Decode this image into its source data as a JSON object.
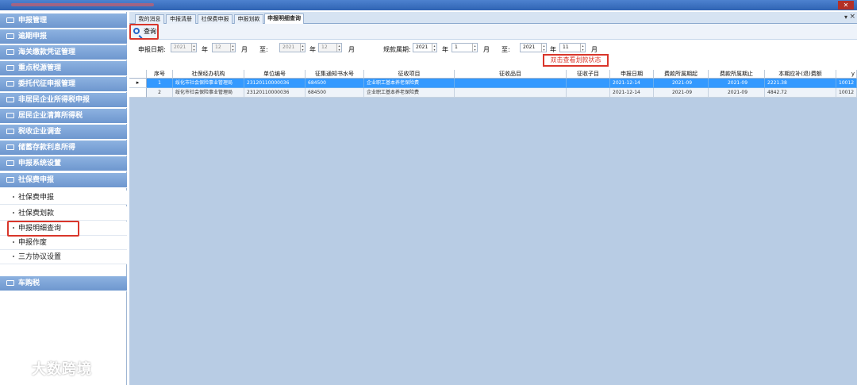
{
  "tabs": [
    "我的消息",
    "申报清册",
    "社保费申报",
    "申报划款",
    "申报明细查询"
  ],
  "toolbar": {
    "query_label": "查询"
  },
  "sidebar": {
    "top_items": [
      "申报管理",
      "逾期申报",
      "海关缴款凭证管理",
      "重点税源管理",
      "委托代征申报管理",
      "非居民企业所得税申报",
      "居民企业清算所得税",
      "税收企业调查",
      "储蓄存款利息所得",
      "申报系统设置",
      "社保费申报"
    ],
    "sub_items": [
      "社保费申报",
      "社保费划款",
      "申报明细查询",
      "申报作废",
      "三方协议设置"
    ],
    "bottom_item": "车购税"
  },
  "filter": {
    "declare_date_label": "申报日期:",
    "from_year": "2021",
    "year_unit": "年",
    "from_month": "12",
    "month_unit": "月",
    "to_label": "至:",
    "to_year": "2021",
    "to_month": "12",
    "period_label": "规款属期:",
    "period_from_year": "2021",
    "period_from_month": "1",
    "period_to_year": "2021",
    "period_to_month": "11",
    "hint": "双击查看划款状态"
  },
  "table": {
    "columns": [
      "序号",
      "社保经办机构",
      "单位编号",
      "征集通知书水号",
      "征收项目",
      "征收品目",
      "征收子目",
      "申报日期",
      "费款所属期起",
      "费款所属期止",
      "本期应补(退)费额",
      "y"
    ],
    "rows": [
      [
        "1",
        "绥化市社会保险事业管理局",
        "23120110000036",
        "684500",
        "企业职工基本养老保险费",
        "",
        "",
        "2021-12-14",
        "2021-09",
        "2021-09",
        "2221.38",
        "10012"
      ],
      [
        "2",
        "绥化市社会保险事业管理局",
        "23120110000036",
        "684500",
        "企业职工基本养老保险费",
        "",
        "",
        "2021-12-14",
        "2021-09",
        "2021-09",
        "4842.72",
        "10012"
      ]
    ]
  },
  "watermark": "大数跨境",
  "colors": {
    "sidebar_header": "#6e97cf",
    "selected_row": "#3399ff",
    "highlight_box": "#d9362b",
    "workspace": "#b8cce4"
  }
}
